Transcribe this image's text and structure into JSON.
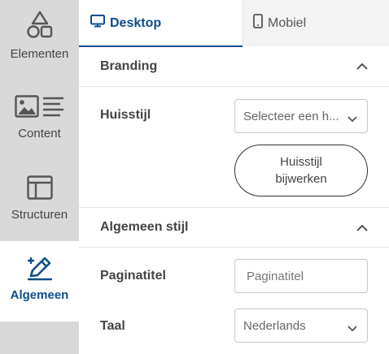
{
  "sidebar": {
    "items": [
      {
        "label": "Elementen",
        "icon": "shapes-icon"
      },
      {
        "label": "Content",
        "icon": "image-text-icon"
      },
      {
        "label": "Structuren",
        "icon": "layout-icon"
      },
      {
        "label": "Algemeen",
        "icon": "pen-icon",
        "active": true
      }
    ]
  },
  "tabs": [
    {
      "label": "Desktop",
      "icon": "monitor-icon",
      "active": true
    },
    {
      "label": "Mobiel",
      "icon": "phone-icon"
    }
  ],
  "branding": {
    "title": "Branding",
    "huisstijl_label": "Huisstijl",
    "huisstijl_placeholder": "Selecteer een h...",
    "update_button_line1": "Huisstijl",
    "update_button_line2": "bijwerken"
  },
  "algemeen": {
    "title": "Algemeen stijl",
    "paginatitel_label": "Paginatitel",
    "paginatitel_placeholder": "Paginatitel",
    "taal_label": "Taal",
    "taal_value": "Nederlands"
  },
  "colors": {
    "accent": "#0d4d8c",
    "sidebar_bg": "#d9d9d9"
  }
}
